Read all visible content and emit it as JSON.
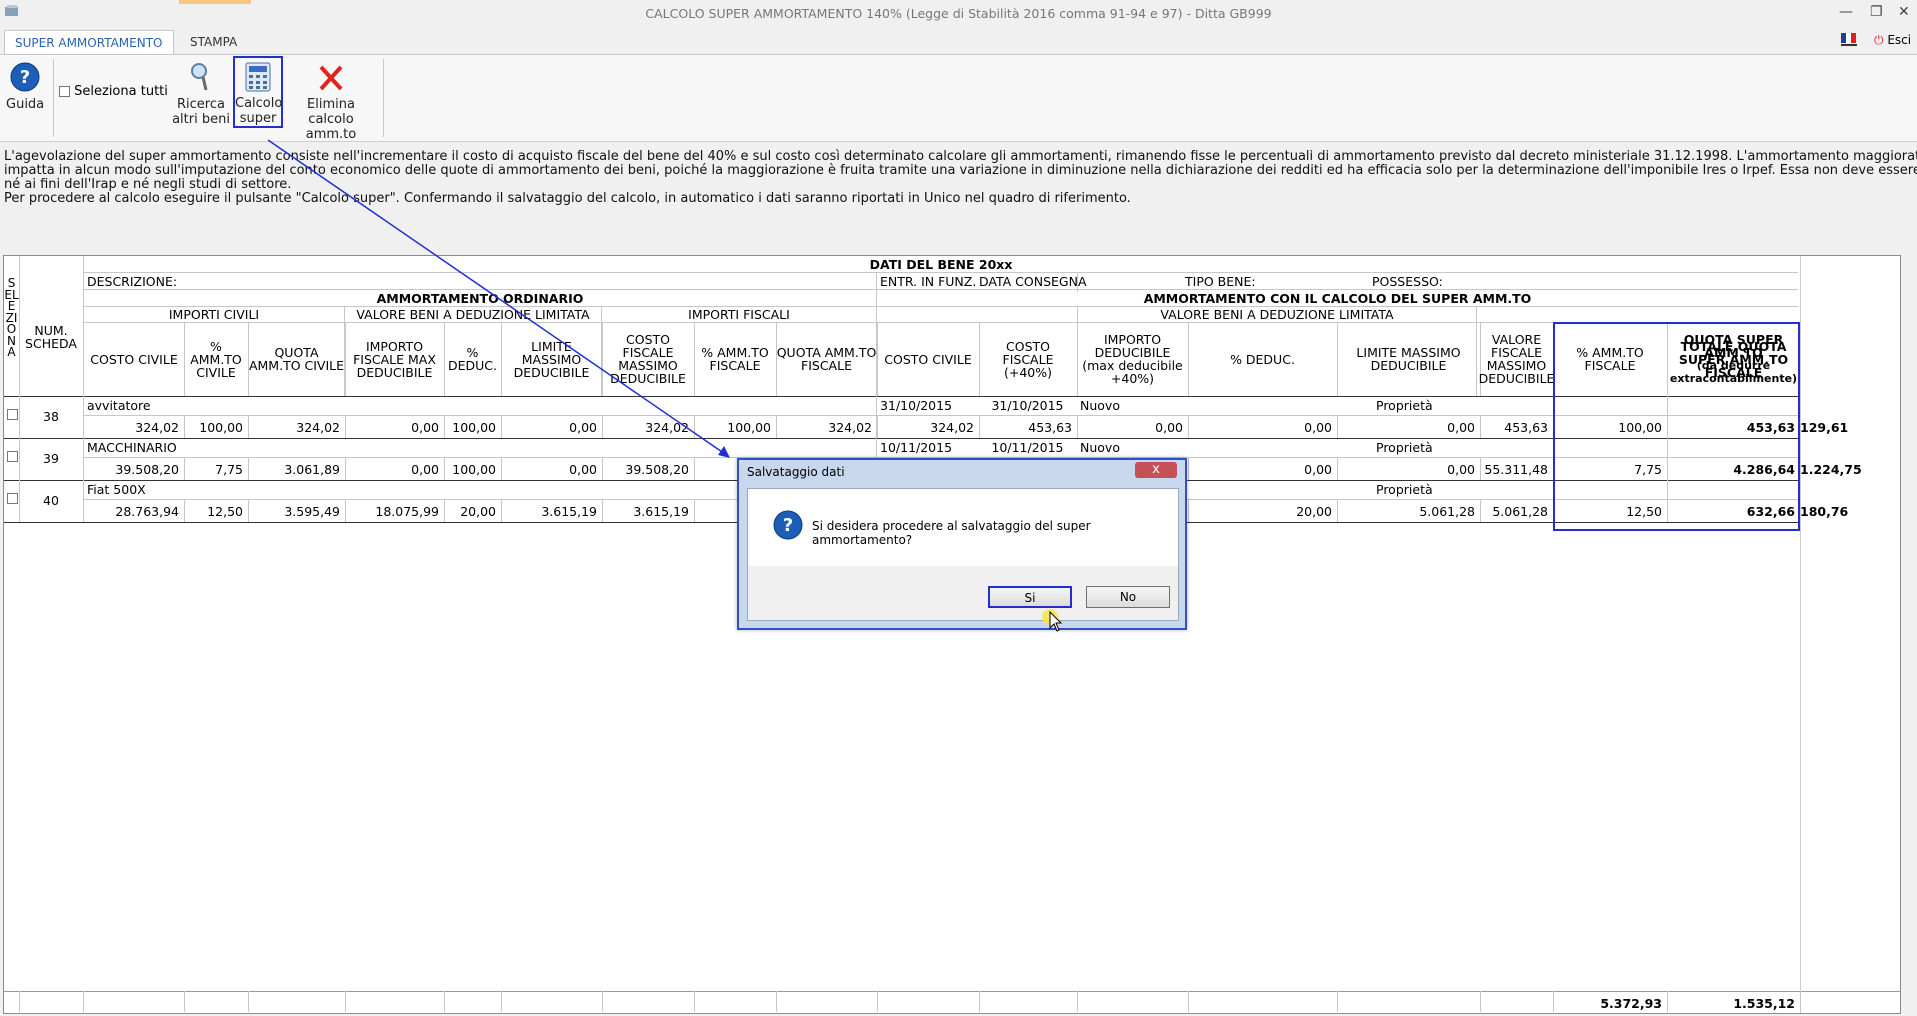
{
  "window": {
    "title": "CALCOLO SUPER AMMORTAMENTO 140% (Legge di Stabilità 2016 comma 91-94 e 97) - Ditta GB999"
  },
  "ribbon": {
    "tabs": [
      "SUPER AMMORTAMENTO",
      "STAMPA"
    ],
    "buttons": {
      "guida": "Guida",
      "seleziona_tutti": "Seleziona tutti",
      "ricerca_1": "Ricerca",
      "ricerca_2": "altri beni",
      "calcolo_1": "Calcolo",
      "calcolo_2": "super",
      "elimina_1": "Elimina calcolo",
      "elimina_2": "amm.to"
    },
    "esci": "Esci"
  },
  "intro": {
    "line1": "L'agevolazione del super ammortamento consiste nell'incrementare il costo di acquisto fiscale del bene del 40% e sul costo così determinato calcolare gli ammortamenti, rimanendo fisse le percentuali di ammortamento previsto dal decreto ministeriale 31.12.1998. L'ammortamento maggiorato non",
    "line2": "impatta in alcun modo sull'imputazione del conto economico delle quote di ammortamento dei beni, poiché la maggiorazione è fruita tramite una variazione in diminuzione nella dichiarazione dei redditi ed ha efficacia solo per la determinazione dell'imponibile Ires o Irpef. Essa non deve essere rilevata",
    "line3": "né ai fini dell'Irap e né negli studi di settore.",
    "line4": "Per procedere al calcolo eseguire il pulsante \"Calcolo super\". Confermando il salvataggio del calcolo, in automatico i dati saranno riportati in Unico nel quadro di riferimento."
  },
  "table": {
    "title": "DATI DEL BENE 20xx",
    "seleziona": "SELEZIONA",
    "num_scheda": "NUM. SCHEDA",
    "descrizione": "DESCRIZIONE:",
    "entr_in_funz": "ENTR. IN FUNZ.",
    "data_consegna": "DATA CONSEGNA",
    "tipo_bene": "TIPO BENE:",
    "possesso": "POSSESSO:",
    "amm_ordinario": "AMMORTAMENTO ORDINARIO",
    "amm_super": "AMMORTAMENTO CON IL CALCOLO DEL SUPER AMM.TO",
    "importi_civili": "IMPORTI CIVILI",
    "valore_beni": "VALORE BENI A DEDUZIONE LIMITATA",
    "importi_fiscali": "IMPORTI FISCALI",
    "valore_beni_2": "VALORE BENI A DEDUZIONE LIMITATA",
    "columns": {
      "costo_civile": "COSTO CIVILE",
      "amm_civile": "% AMM.TO CIVILE",
      "quota_civile": "QUOTA AMM.TO CIVILE",
      "imp_fiscale_max": "IMPORTO FISCALE MAX DEDUCIBILE",
      "deduc": "% DEDUC.",
      "limite_max": "LIMITE MASSIMO DEDUCIBILE",
      "costo_fiscale_max": "COSTO FISCALE MASSIMO DEDUCIBILE",
      "amm_fiscale": "% AMM.TO FISCALE",
      "quota_fiscale": "QUOTA AMM.TO FISCALE",
      "costo_civile_s": "COSTO CIVILE",
      "costo_fiscale_40": "COSTO FISCALE (+40%)",
      "imp_deducibile_40": "IMPORTO DEDUCIBILE (max deducibile +40%)",
      "deduc_s": "% DEDUC.",
      "limite_max_s": "LIMITE MASSIMO DEDUCIBILE",
      "valore_fiscale_max": "VALORE FISCALE MASSIMO DEDUCIBILE",
      "amm_fiscale_s": "% AMM.TO FISCALE",
      "totale_quota": "TOTALE QUOTA SUPER AMM.TO FISCALE",
      "quota_super_1": "QUOTA SUPER AMM.TO",
      "quota_super_2": "(da dedurre extracontabilmente)"
    },
    "rows": [
      {
        "num": "38",
        "desc": "avvitatore",
        "entr": "31/10/2015",
        "cons": "31/10/2015",
        "tipo": "Nuovo",
        "poss": "Proprietà",
        "v": [
          "324,02",
          "100,00",
          "324,02",
          "0,00",
          "100,00",
          "0,00",
          "324,02",
          "100,00",
          "324,02",
          "324,02",
          "453,63",
          "0,00",
          "0,00",
          "0,00",
          "453,63",
          "100,00",
          "453,63",
          "129,61"
        ]
      },
      {
        "num": "39",
        "desc": "MACCHINARIO",
        "entr": "10/11/2015",
        "cons": "10/11/2015",
        "tipo": "Nuovo",
        "poss": "Proprietà",
        "v": [
          "39.508,20",
          "7,75",
          "3.061,89",
          "0,00",
          "100,00",
          "0,00",
          "39.508,20",
          "",
          "",
          "",
          "",
          "",
          "0,00",
          "0,00",
          "55.311,48",
          "7,75",
          "4.286,64",
          "1.224,75"
        ]
      },
      {
        "num": "40",
        "desc": "Fiat 500X",
        "entr": "",
        "cons": "",
        "tipo": "",
        "poss": "Proprietà",
        "v": [
          "28.763,94",
          "12,50",
          "3.595,49",
          "18.075,99",
          "20,00",
          "3.615,19",
          "3.615,19",
          "",
          "",
          "",
          "",
          "",
          "20,00",
          "5.061,28",
          "5.061,28",
          "12,50",
          "632,66",
          "180,76"
        ]
      }
    ],
    "totals": {
      "totale_quota": "5.372,93",
      "quota_super": "1.535,12"
    }
  },
  "dialog": {
    "title": "Salvataggio dati",
    "message": "Si desidera procedere al salvataggio del super ammortamento?",
    "yes": "Si",
    "no": "No",
    "close": "x"
  },
  "colors": {
    "accent": "#2a62b0",
    "highlight_border": "#1f2fd0",
    "close_red": "#c6505a"
  }
}
